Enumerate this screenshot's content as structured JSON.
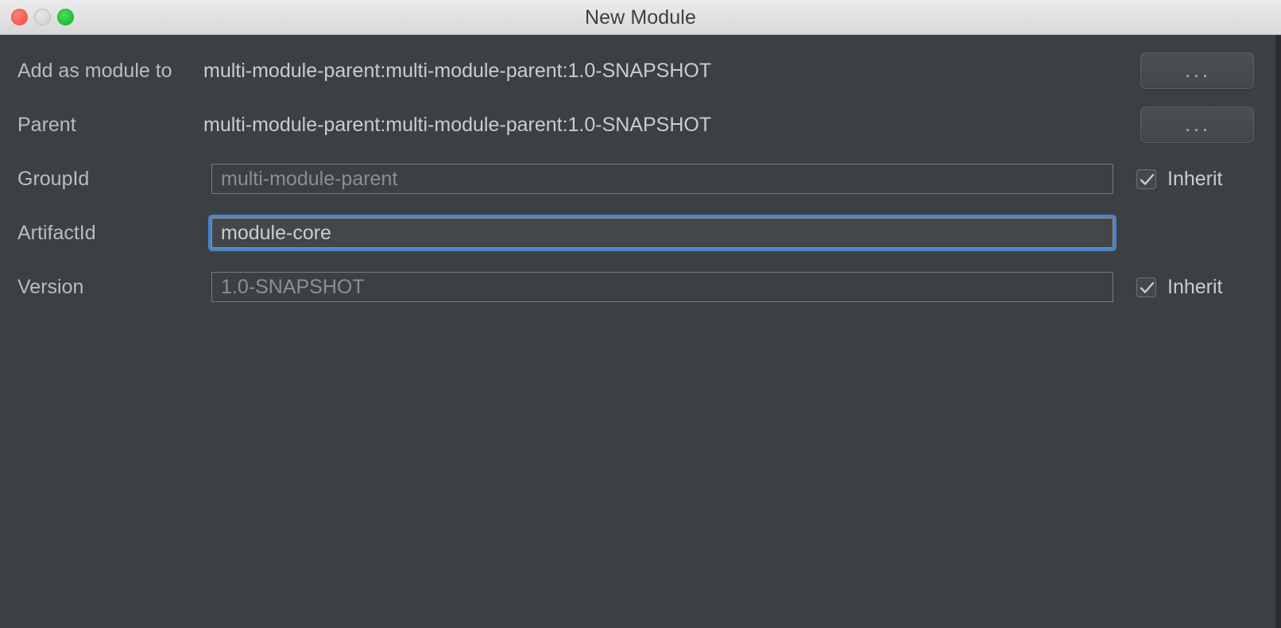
{
  "window": {
    "title": "New Module",
    "traffic_lights": [
      {
        "name": "close",
        "color": "#ff5f57"
      },
      {
        "name": "minimize",
        "color": "#d9d9d9"
      },
      {
        "name": "maximize",
        "color": "#23c63a"
      }
    ],
    "background": "#3c4043",
    "accent": "#4a83c4"
  },
  "form": {
    "rows": [
      {
        "label": "Add as module to",
        "kind": "value",
        "value": "multi-module-parent:multi-module-parent:1.0-SNAPSHOT",
        "button": "...",
        "inherit": null
      },
      {
        "label": "Parent",
        "kind": "value",
        "value": "multi-module-parent:multi-module-parent:1.0-SNAPSHOT",
        "button": "...",
        "inherit": null
      },
      {
        "label": "GroupId",
        "kind": "field",
        "value": "multi-module-parent",
        "button": null,
        "inherit": "Inherit"
      },
      {
        "label": "ArtifactId",
        "kind": "field",
        "value": "module-core",
        "button": null,
        "inherit": null
      },
      {
        "label": "Version",
        "kind": "field",
        "value": "1.0-SNAPSHOT",
        "button": null,
        "inherit": "Inherit"
      }
    ]
  }
}
